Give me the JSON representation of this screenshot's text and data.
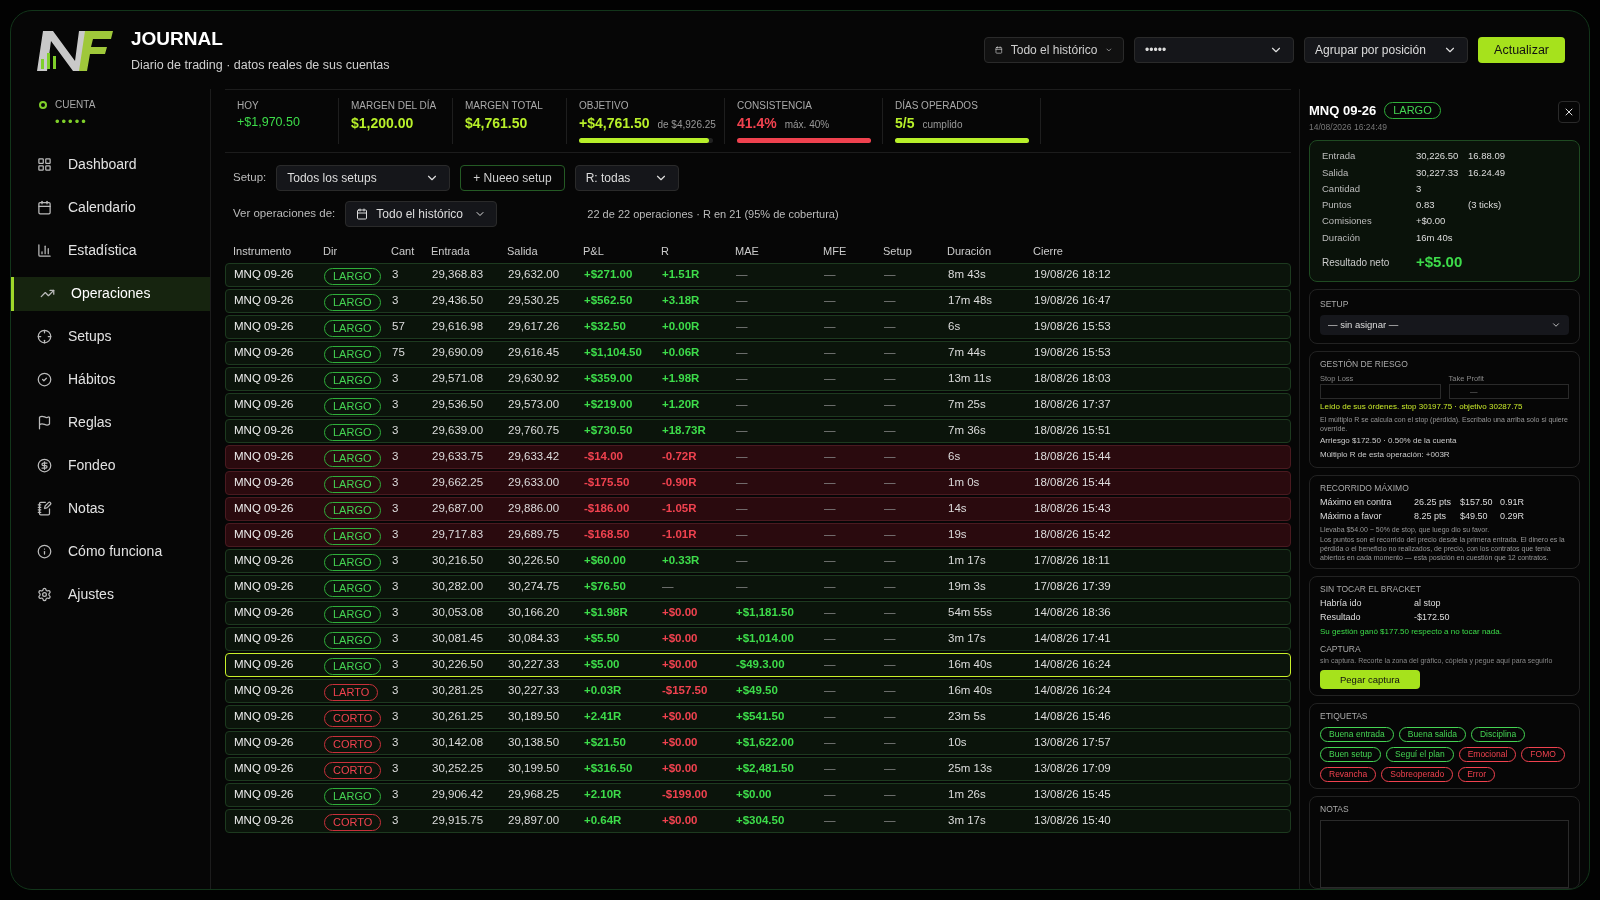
{
  "app": {
    "title": "JOURNAL",
    "subtitle": "Diario de trading · datos reales de sus cuentas"
  },
  "toolbar": {
    "range": "Todo el histórico",
    "account": "•••••",
    "group": "Agrupar por posición",
    "refresh": "Actualizar"
  },
  "account": {
    "label": "CUENTA",
    "value": "•••••"
  },
  "sidebar": {
    "items": [
      {
        "label": "Dashboard",
        "selected": false
      },
      {
        "label": "Calendario",
        "selected": false
      },
      {
        "label": "Estadística",
        "selected": false
      },
      {
        "label": "Operaciones",
        "selected": true
      },
      {
        "label": "Setups",
        "selected": false
      },
      {
        "label": "Hábitos",
        "selected": false
      },
      {
        "label": "Reglas",
        "selected": false
      },
      {
        "label": "Fondeo",
        "selected": false
      },
      {
        "label": "Notas",
        "selected": false
      },
      {
        "label": "Cómo funciona",
        "selected": false
      },
      {
        "label": "Ajustes",
        "selected": false
      }
    ]
  },
  "stats": [
    {
      "kind": "plain",
      "label": "HOY",
      "value": "+$1,970.50",
      "color": "#3ddc4a"
    },
    {
      "kind": "plain",
      "label": "MARGEN DEL DÍA",
      "value": "$1,200.00",
      "color": "#b8f02a"
    },
    {
      "kind": "plain",
      "label": "MARGEN TOTAL",
      "value": "$4,761.50",
      "color": "#b8f02a"
    },
    {
      "kind": "bar",
      "label": "OBJETIVO",
      "value": "+$4,761.50",
      "note": "de $4,926.25",
      "color": "#b8f02a",
      "level": 0.97
    },
    {
      "kind": "bar",
      "label": "CONSISTENCIA",
      "value": "41.4%",
      "note": "máx. 40%",
      "color": "#f0424f",
      "level": 1
    },
    {
      "kind": "bar",
      "label": "DÍAS OPERADOS",
      "value": "5/5",
      "note": "cumplido",
      "color": "#b8f02a",
      "level": 1
    }
  ],
  "filters": {
    "setup_label": "Setup:",
    "setup": "Todos los setups",
    "new_setup": "+ Nueeo setup",
    "r": "R: todas",
    "view_label": "Ver operaciones de:",
    "view": "Todo el histórico",
    "summary": "22 de 22 operaciones · R en 21 (95% de cobertura)"
  },
  "table": {
    "columns": [
      "Instrumento",
      "Dir",
      "Cant",
      "Entrada",
      "Salida",
      "P&L",
      "R",
      "MAE",
      "MFE",
      "Setup",
      "Duración",
      "Cierre"
    ],
    "rows": [
      {
        "kind": "win",
        "selected": false,
        "instrument": "MNQ 09-26",
        "dir": {
          "text": "LARGO",
          "kind": "long"
        },
        "qty": "3",
        "entry": "29,368.83",
        "exit": "29,632.00",
        "pnl": {
          "text": "+$271.00",
          "color": "#3ddc4a"
        },
        "r": {
          "text": "+1.51R",
          "color": "#3ddc4a"
        },
        "mae": {
          "text": "—"
        },
        "mfe": "—",
        "setup": "—",
        "duration": "8m 43s",
        "close": "19/08/26 18:12"
      },
      {
        "kind": "win",
        "selected": false,
        "instrument": "MNQ 09-26",
        "dir": {
          "text": "LARGO",
          "kind": "long"
        },
        "qty": "3",
        "entry": "29,436.50",
        "exit": "29,530.25",
        "pnl": {
          "text": "+$562.50",
          "color": "#3ddc4a"
        },
        "r": {
          "text": "+3.18R",
          "color": "#3ddc4a"
        },
        "mae": {
          "text": "—"
        },
        "mfe": "—",
        "setup": "—",
        "duration": "17m 48s",
        "close": "19/08/26 16:47"
      },
      {
        "kind": "win",
        "selected": false,
        "instrument": "MNQ 09-26",
        "dir": {
          "text": "LARGO",
          "kind": "long"
        },
        "qty": "57",
        "entry": "29,616.98",
        "exit": "29,617.26",
        "pnl": {
          "text": "+$32.50",
          "color": "#3ddc4a"
        },
        "r": {
          "text": "+0.00R",
          "color": "#3ddc4a"
        },
        "mae": {
          "text": "—"
        },
        "mfe": "—",
        "setup": "—",
        "duration": "6s",
        "close": "19/08/26 15:53"
      },
      {
        "kind": "win",
        "selected": false,
        "instrument": "MNQ 09-26",
        "dir": {
          "text": "LARGO",
          "kind": "long"
        },
        "qty": "75",
        "entry": "29,690.09",
        "exit": "29,616.45",
        "pnl": {
          "text": "+$1,104.50",
          "color": "#3ddc4a"
        },
        "r": {
          "text": "+0.06R",
          "color": "#3ddc4a"
        },
        "mae": {
          "text": "—"
        },
        "mfe": "—",
        "setup": "—",
        "duration": "7m 44s",
        "close": "19/08/26 15:53"
      },
      {
        "kind": "win",
        "selected": false,
        "instrument": "MNQ 09-26",
        "dir": {
          "text": "LARGO",
          "kind": "long"
        },
        "qty": "3",
        "entry": "29,571.08",
        "exit": "29,630.92",
        "pnl": {
          "text": "+$359.00",
          "color": "#3ddc4a"
        },
        "r": {
          "text": "+1.98R",
          "color": "#3ddc4a"
        },
        "mae": {
          "text": "—"
        },
        "mfe": "—",
        "setup": "—",
        "duration": "13m 11s",
        "close": "18/08/26 18:03"
      },
      {
        "kind": "win",
        "selected": false,
        "instrument": "MNQ 09-26",
        "dir": {
          "text": "LARGO",
          "kind": "long"
        },
        "qty": "3",
        "entry": "29,536.50",
        "exit": "29,573.00",
        "pnl": {
          "text": "+$219.00",
          "color": "#3ddc4a"
        },
        "r": {
          "text": "+1.20R",
          "color": "#3ddc4a"
        },
        "mae": {
          "text": "—"
        },
        "mfe": "—",
        "setup": "—",
        "duration": "7m 25s",
        "close": "18/08/26 17:37"
      },
      {
        "kind": "win",
        "selected": false,
        "instrument": "MNQ 09-26",
        "dir": {
          "text": "LARGO",
          "kind": "long"
        },
        "qty": "3",
        "entry": "29,639.00",
        "exit": "29,760.75",
        "pnl": {
          "text": "+$730.50",
          "color": "#3ddc4a"
        },
        "r": {
          "text": "+18.73R",
          "color": "#3ddc4a"
        },
        "mae": {
          "text": "—"
        },
        "mfe": "—",
        "setup": "—",
        "duration": "7m 36s",
        "close": "18/08/26 15:51"
      },
      {
        "kind": "loss",
        "selected": false,
        "instrument": "MNQ 09-26",
        "dir": {
          "text": "LARGO",
          "kind": "long"
        },
        "qty": "3",
        "entry": "29,633.75",
        "exit": "29,633.42",
        "pnl": {
          "text": "-$14.00",
          "color": "#f0424f"
        },
        "r": {
          "text": "-0.72R",
          "color": "#f0424f"
        },
        "mae": {
          "text": "—"
        },
        "mfe": "—",
        "setup": "—",
        "duration": "6s",
        "close": "18/08/26 15:44"
      },
      {
        "kind": "loss",
        "selected": false,
        "instrument": "MNQ 09-26",
        "dir": {
          "text": "LARGO",
          "kind": "long"
        },
        "qty": "3",
        "entry": "29,662.25",
        "exit": "29,633.00",
        "pnl": {
          "text": "-$175.50",
          "color": "#f0424f"
        },
        "r": {
          "text": "-0.90R",
          "color": "#f0424f"
        },
        "mae": {
          "text": "—"
        },
        "mfe": "—",
        "setup": "—",
        "duration": "1m 0s",
        "close": "18/08/26 15:44"
      },
      {
        "kind": "loss",
        "selected": false,
        "instrument": "MNQ 09-26",
        "dir": {
          "text": "LARGO",
          "kind": "long"
        },
        "qty": "3",
        "entry": "29,687.00",
        "exit": "29,886.00",
        "pnl": {
          "text": "-$186.00",
          "color": "#f0424f"
        },
        "r": {
          "text": "-1.05R",
          "color": "#f0424f"
        },
        "mae": {
          "text": "—"
        },
        "mfe": "—",
        "setup": "—",
        "duration": "14s",
        "close": "18/08/26 15:43"
      },
      {
        "kind": "loss",
        "selected": false,
        "instrument": "MNQ 09-26",
        "dir": {
          "text": "LARGO",
          "kind": "long"
        },
        "qty": "3",
        "entry": "29,717.83",
        "exit": "29,689.75",
        "pnl": {
          "text": "-$168.50",
          "color": "#f0424f"
        },
        "r": {
          "text": "-1.01R",
          "color": "#f0424f"
        },
        "mae": {
          "text": "—"
        },
        "mfe": "—",
        "setup": "—",
        "duration": "19s",
        "close": "18/08/26 15:42"
      },
      {
        "kind": "win",
        "selected": false,
        "instrument": "MNQ 09-26",
        "dir": {
          "text": "LARGO",
          "kind": "long"
        },
        "qty": "3",
        "entry": "30,216.50",
        "exit": "30,226.50",
        "pnl": {
          "text": "+$60.00",
          "color": "#3ddc4a"
        },
        "r": {
          "text": "+0.33R",
          "color": "#3ddc4a"
        },
        "mae": {
          "text": "—"
        },
        "mfe": "—",
        "setup": "—",
        "duration": "1m 17s",
        "close": "17/08/26 18:11"
      },
      {
        "kind": "win",
        "selected": false,
        "instrument": "MNQ 09-26",
        "dir": {
          "text": "LARGO",
          "kind": "long"
        },
        "qty": "3",
        "entry": "30,282.00",
        "exit": "30,274.75",
        "pnl": {
          "text": "+$76.50",
          "color": "#3ddc4a"
        },
        "r": {
          "text": "—"
        },
        "mae": {
          "text": "—"
        },
        "mfe": "—",
        "setup": "—",
        "duration": "19m 3s",
        "close": "17/08/26 17:39"
      },
      {
        "kind": "win",
        "selected": false,
        "instrument": "MNQ 09-26",
        "dir": {
          "text": "LARGO",
          "kind": "long"
        },
        "qty": "3",
        "entry": "30,053.08",
        "exit": "30,166.20",
        "pnl": {
          "text": "+$1.98R",
          "color": "#3ddc4a"
        },
        "r": {
          "text": "+$0.00",
          "color": "#f0424f"
        },
        "mae": {
          "text": "+$1,181.50",
          "color": "#3ddc4a"
        },
        "mfe": "—",
        "setup": "—",
        "duration": "54m 55s",
        "close": "14/08/26 18:36"
      },
      {
        "kind": "win",
        "selected": false,
        "instrument": "MNQ 09-26",
        "dir": {
          "text": "LARGO",
          "kind": "long"
        },
        "qty": "3",
        "entry": "30,081.45",
        "exit": "30,084.33",
        "pnl": {
          "text": "+$5.50",
          "color": "#3ddc4a"
        },
        "r": {
          "text": "+$0.00",
          "color": "#f0424f"
        },
        "mae": {
          "text": "+$1,014.00",
          "color": "#3ddc4a"
        },
        "mfe": "—",
        "setup": "—",
        "duration": "3m 17s",
        "close": "14/08/26 17:41"
      },
      {
        "kind": "win",
        "selected": true,
        "instrument": "MNQ 09-26",
        "dir": {
          "text": "LARGO",
          "kind": "long"
        },
        "qty": "3",
        "entry": "30,226.50",
        "exit": "30,227.33",
        "pnl": {
          "text": "+$5.00",
          "color": "#3ddc4a"
        },
        "r": {
          "text": "+$0.00",
          "color": "#f0424f"
        },
        "mae": {
          "text": "-$49.3.00",
          "color": "#3ddc4a"
        },
        "mfe": "—",
        "setup": "—",
        "duration": "16m 40s",
        "close": "14/08/26 16:24"
      },
      {
        "kind": "win",
        "selected": false,
        "instrument": "MNQ 09-26",
        "dir": {
          "text": "LARTO",
          "kind": "short"
        },
        "qty": "3",
        "entry": "30,281.25",
        "exit": "30,227.33",
        "pnl": {
          "text": "+0.03R",
          "color": "#3ddc4a"
        },
        "r": {
          "text": "-$157.50",
          "color": "#f0424f"
        },
        "mae": {
          "text": "+$49.50",
          "color": "#3ddc4a"
        },
        "mfe": "—",
        "setup": "—",
        "duration": "16m 40s",
        "close": "14/08/26 16:24"
      },
      {
        "kind": "win",
        "selected": false,
        "instrument": "MNQ 09-26",
        "dir": {
          "text": "CORTO",
          "kind": "short"
        },
        "qty": "3",
        "entry": "30,261.25",
        "exit": "30,189.50",
        "pnl": {
          "text": "+2.41R",
          "color": "#3ddc4a"
        },
        "r": {
          "text": "+$0.00",
          "color": "#f0424f"
        },
        "mae": {
          "text": "+$541.50",
          "color": "#3ddc4a"
        },
        "mfe": "—",
        "setup": "—",
        "duration": "23m 5s",
        "close": "14/08/26 15:46"
      },
      {
        "kind": "win",
        "selected": false,
        "instrument": "MNQ 09-26",
        "dir": {
          "text": "CORTO",
          "kind": "short"
        },
        "qty": "3",
        "entry": "30,142.08",
        "exit": "30,138.50",
        "pnl": {
          "text": "+$21.50",
          "color": "#3ddc4a"
        },
        "r": {
          "text": "+$0.00",
          "color": "#f0424f"
        },
        "mae": {
          "text": "+$1,622.00",
          "color": "#3ddc4a"
        },
        "mfe": "—",
        "setup": "—",
        "duration": "10s",
        "close": "13/08/26 17:57"
      },
      {
        "kind": "win",
        "selected": false,
        "instrument": "MNQ 09-26",
        "dir": {
          "text": "CORTO",
          "kind": "short"
        },
        "qty": "3",
        "entry": "30,252.25",
        "exit": "30,199.50",
        "pnl": {
          "text": "+$316.50",
          "color": "#3ddc4a"
        },
        "r": {
          "text": "+$0.00",
          "color": "#f0424f"
        },
        "mae": {
          "text": "+$2,481.50",
          "color": "#3ddc4a"
        },
        "mfe": "—",
        "setup": "—",
        "duration": "25m 13s",
        "close": "13/08/26 17:09"
      },
      {
        "kind": "win",
        "selected": false,
        "instrument": "MNQ 09-26",
        "dir": {
          "text": "LARGO",
          "kind": "long"
        },
        "qty": "3",
        "entry": "29,906.42",
        "exit": "29,968.25",
        "pnl": {
          "text": "+2.10R",
          "color": "#3ddc4a"
        },
        "r": {
          "text": "-$199.00",
          "color": "#f0424f"
        },
        "mae": {
          "text": "+$0.00",
          "color": "#3ddc4a"
        },
        "mfe": "—",
        "setup": "—",
        "duration": "1m 26s",
        "close": "13/08/26 15:45"
      },
      {
        "kind": "win",
        "selected": false,
        "instrument": "MNQ 09-26",
        "dir": {
          "text": "CORTO",
          "kind": "short"
        },
        "qty": "3",
        "entry": "29,915.75",
        "exit": "29,897.00",
        "pnl": {
          "text": "+0.64R",
          "color": "#3ddc4a"
        },
        "r": {
          "text": "+$0.00",
          "color": "#f0424f"
        },
        "mae": {
          "text": "+$304.50",
          "color": "#3ddc4a"
        },
        "mfe": "—",
        "setup": "—",
        "duration": "3m 17s",
        "close": "13/08/26 15:40"
      }
    ]
  },
  "detail": {
    "title": "MNQ 09-26",
    "dir": {
      "text": "LARGO",
      "kind": "long"
    },
    "date": "14/08/2026 16:24:49",
    "facts": [
      {
        "label": "Entrada",
        "value": "30,226.50",
        "extra": "16.88.09"
      },
      {
        "label": "Salida",
        "value": "30,227.33",
        "extra": "16.24.49"
      },
      {
        "label": "Cantidad",
        "value": "3"
      },
      {
        "label": "Puntos",
        "value": "0.83",
        "extra": "(3 ticks)"
      },
      {
        "label": "Comisiones",
        "value": "+$0.00"
      },
      {
        "label": "Duración",
        "value": "16m 40s"
      }
    ],
    "net_label": "Resultado neto",
    "net": "+$5.00",
    "setup": {
      "title": "SETUP",
      "value": "— sin asignar —"
    },
    "risk": {
      "title": "GESTIÓN DE RIESGO",
      "stop_label": "Stop Loss",
      "tp_label": "Take Profit",
      "tp_value": "—",
      "read": "Leído de sus órdenes. stop 30197.75 · objetivo 30287.75",
      "hint": "El múltiplo R se calcula con el stop (pérdida). Escríbalo una arriba solo si quiere override.",
      "risk": "Arriesgo $172.50 · 0.50% de la cuenta",
      "multiple": "Múltiplo R de esta operación: +003R"
    },
    "excursion": {
      "title": "RECORRIDO MÁXIMO",
      "rows": [
        {
          "label": "Máximo en contra",
          "pts": "26.25 pts",
          "usd": "$157.50",
          "r": "0.91R"
        },
        {
          "label": "Máximo a favor",
          "pts": "8.25 pts",
          "usd": "$49.50",
          "r": "0.29R"
        }
      ],
      "note": "Llevaba $54.00 − 50% de stop, que luego dio su favor.",
      "explain": "Los puntos son el recorrido del precio desde la primera entrada. El dinero es la pérdida o el beneficio no realizados, de precio, con los contratos que tenía abiertos en cada momento — esta posición en cuestión que 12 contratos."
    },
    "bracket": {
      "title": "SIN TOCAR EL BRACKET",
      "rows": [
        {
          "label": "Habría ido",
          "value": "al stop"
        },
        {
          "label": "Resultado",
          "value": "-$172.50"
        }
      ],
      "gain": "Su gestión ganó $177.50 respecto a no tocar nada.",
      "capture_title": "CAPTURA",
      "capture_hint": "sin captura. Recorte la zona del gráfico, cópiela y pegue aquí para seguirlo",
      "paste": "Pegar captura"
    },
    "tags": {
      "title": "ETIQUETAS",
      "items": [
        {
          "label": "Buena entrada",
          "color": "#45d453"
        },
        {
          "label": "Buena salida",
          "color": "#45d453"
        },
        {
          "label": "Disciplina",
          "color": "#45d453"
        },
        {
          "label": "Buen setup",
          "color": "#45d453"
        },
        {
          "label": "Seguí el plan",
          "color": "#45d453"
        },
        {
          "label": "Emocional",
          "color": "#f0424f"
        },
        {
          "label": "FOMO",
          "color": "#f0424f"
        },
        {
          "label": "Revancha",
          "color": "#f0424f"
        },
        {
          "label": "Sobreoperado",
          "color": "#f0424f"
        },
        {
          "label": "Error",
          "color": "#f0424f"
        }
      ]
    },
    "notes": {
      "title": "NOTAS"
    }
  }
}
